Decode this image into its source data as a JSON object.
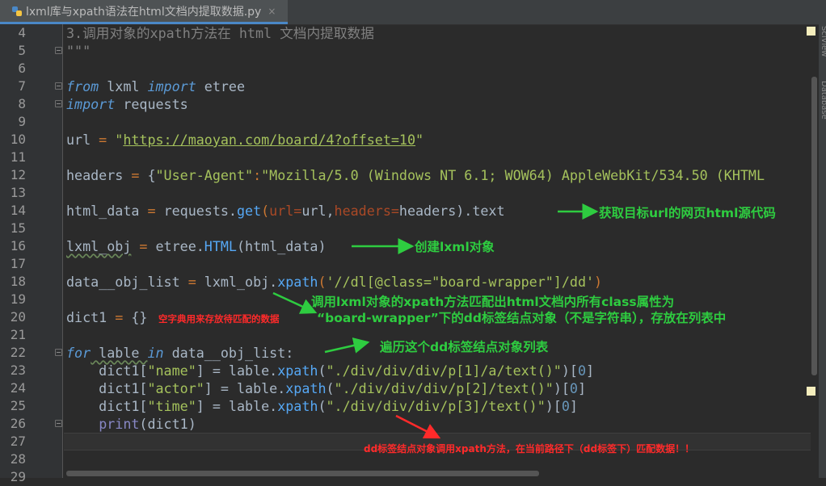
{
  "tab": {
    "title": "lxml库与xpath语法在html文档内提取数据.py",
    "close": "×"
  },
  "line_numbers": [
    "4",
    "5",
    "6",
    "7",
    "8",
    "9",
    "10",
    "11",
    "12",
    "13",
    "14",
    "15",
    "16",
    "17",
    "18",
    "19",
    "20",
    "21",
    "22",
    "23",
    "24",
    "25",
    "26",
    "27",
    "28",
    "29"
  ],
  "code": {
    "l4_comment": "3.调用对象的xpath方法在 html 文档内提取数据",
    "l5_docstring": "\"\"\"",
    "l7_from": "from",
    "l7_mod": " lxml ",
    "l7_import": "import",
    "l7_name": " etree",
    "l8_import": "import",
    "l8_name": " requests",
    "l10_var": "url",
    "l10_eq": " = ",
    "l10_q1": "\"",
    "l10_url": "https://maoyan.com/board/4?offset=10",
    "l10_q2": "\"",
    "l12_var": "headers",
    "l12_eq": " = ",
    "l12_brace": "{",
    "l12_key": "\"User-Agent\"",
    "l12_colon": ":",
    "l12_val": "\"Mozilla/5.0 (Windows NT 6.1; WOW64) AppleWebKit/534.50 (KHTML",
    "l14_var": "html_data",
    "l14_eq": " = ",
    "l14_obj": "requests.",
    "l14_fn": "get",
    "l14_p1": "(",
    "l14_kw1": "url=",
    "l14_v1": "url,",
    "l14_kw2": "headers=",
    "l14_v2": "headers).text",
    "l16_var": "lxml_obj",
    "l16_eq": " = ",
    "l16_obj": "etree.",
    "l16_fn": "HTML",
    "l16_args": "(html_data)",
    "l18_var": "data__obj_list",
    "l18_eq": " = ",
    "l18_obj": "lxml_obj.",
    "l18_fn": "xpath",
    "l18_p1": "(",
    "l18_str": "'//dl[@class=\"board-wrapper\"]/dd'",
    "l18_p2": ")",
    "l20_var": "dict1",
    "l20_eq": " = ",
    "l20_val": "{}",
    "l22_for": "for",
    "l22_var": " lable ",
    "l22_in": "in",
    "l22_rest": " data__obj_list:",
    "l23_a": "    dict1[",
    "l23_key": "\"name\"",
    "l23_b": "] = lable.",
    "l23_fn": "xpath",
    "l23_c": "(",
    "l23_str": "\"./div/div/div/p[1]/a/text()\"",
    "l23_d": ")[",
    "l23_num": "0",
    "l23_e": "]",
    "l24_a": "    dict1[",
    "l24_key": "\"actor\"",
    "l24_b": "] = lable.",
    "l24_fn": "xpath",
    "l24_c": "(",
    "l24_str": "\"./div/div/div/p[2]/text()\"",
    "l24_d": ")[",
    "l24_num": "0",
    "l24_e": "]",
    "l25_a": "    dict1[",
    "l25_key": "\"time\"",
    "l25_b": "] = lable.",
    "l25_fn": "xpath",
    "l25_c": "(",
    "l25_str": "\"./div/div/div/p[3]/text()\"",
    "l25_d": ")[",
    "l25_num": "0",
    "l25_e": "]",
    "l26_indent": "    ",
    "l26_fn": "print",
    "l26_args": "(dict1)"
  },
  "annotations": {
    "a14": "获取目标url的网页html源代码",
    "a16": "创建lxml对象",
    "a18_line1": "调用lxml对象的xpath方法匹配出html文档内所有class属性为",
    "a18_line2": "“board-wrapper”下的dd标签结点对象（不是字符串），存放在列表中",
    "a20": "空字典用来存放待匹配的数据",
    "a22": "遍历这个dd标签结点对象列表",
    "a27": "dd标签结点对象调用xpath方法，在当前路径下（dd标签下）匹配数据！！"
  },
  "sidebar": {
    "scview": "SciView",
    "database": "Database"
  },
  "colors": {
    "arrow_green": "#2ecc40",
    "arrow_red": "#ff2a2a",
    "background": "#2b2b2b"
  }
}
